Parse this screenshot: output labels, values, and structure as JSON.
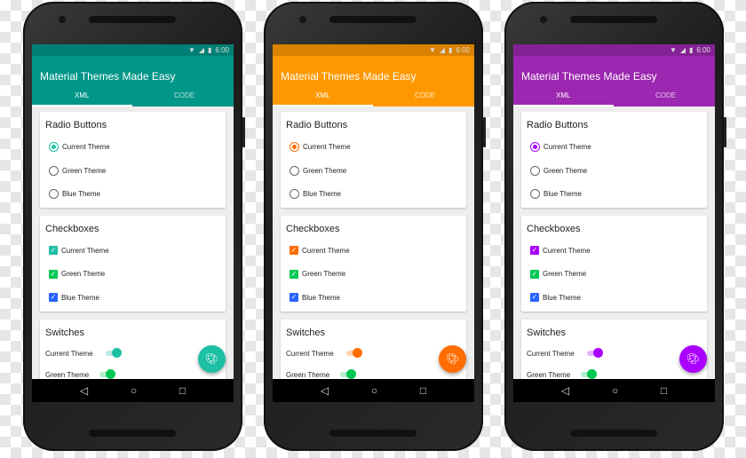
{
  "labels": {
    "status_time": "6:00",
    "app_title": "Material Themes Made Easy",
    "tabs": [
      "XML",
      "CODE"
    ],
    "radio_title": "Radio Buttons",
    "checkbox_title": "Checkboxes",
    "switch_title": "Switches",
    "options": [
      "Current Theme",
      "Green Theme",
      "Blue Theme"
    ]
  },
  "phones": [
    {
      "theme": "teal",
      "primary": "#009688",
      "accent": "#1dbfa5"
    },
    {
      "theme": "orange",
      "primary": "#ff9800",
      "accent": "#ff6d00"
    },
    {
      "theme": "purple",
      "primary": "#9c27b0",
      "accent": "#aa00ff"
    }
  ],
  "colors": {
    "green": "#00c853",
    "blue": "#2962ff"
  },
  "icons": {
    "fab": "palette-icon",
    "nav": [
      "back-icon",
      "home-icon",
      "recents-icon"
    ],
    "status": [
      "wifi-icon",
      "signal-icon",
      "battery-icon"
    ]
  }
}
